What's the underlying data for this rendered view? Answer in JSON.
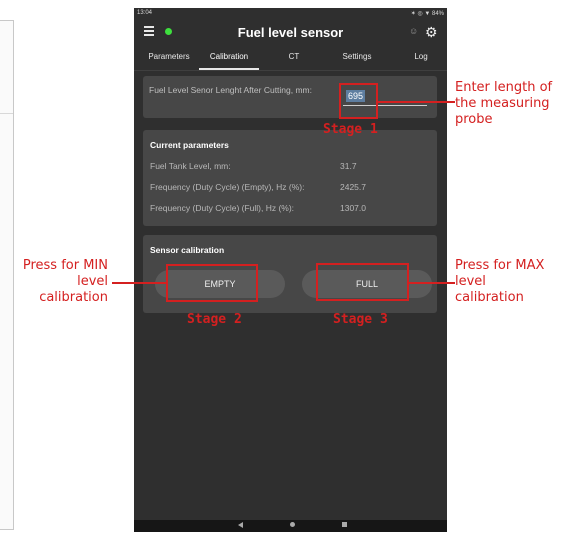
{
  "status_bar": {
    "time": "13:04",
    "right": "✶ ◎ ▼ 84%"
  },
  "app_bar": {
    "title": "Fuel level sensor"
  },
  "tabs": [
    {
      "label": "Parameters"
    },
    {
      "label": "Calibration"
    },
    {
      "label": "CT"
    },
    {
      "label": "Settings"
    },
    {
      "label": "Log"
    }
  ],
  "probe_field": {
    "label": "Fuel Level Senor Lenght After Cutting, mm:",
    "value": "695"
  },
  "current_parameters": {
    "title": "Current parameters",
    "rows": [
      {
        "label": "Fuel Tank Level, mm:",
        "value": "31.7"
      },
      {
        "label": "Frequency (Duty Cycle) (Empty), Hz (%):",
        "value": "2425.7"
      },
      {
        "label": "Frequency (Duty Cycle) (Full), Hz (%):",
        "value": "1307.0"
      }
    ]
  },
  "sensor_calibration": {
    "title": "Sensor calibration",
    "empty_label": "EMPTY",
    "full_label": "FULL"
  },
  "annotations": {
    "stage1": "Stage 1",
    "stage2": "Stage 2",
    "stage3": "Stage 3",
    "probe_note": [
      "Enter length of",
      "the measuring",
      "probe"
    ],
    "min_note": [
      "Press for MIN",
      "level",
      "calibration"
    ],
    "max_note": [
      "Press for MAX",
      "level",
      "calibration"
    ]
  },
  "colors": {
    "accent_red": "#d42020",
    "status_dot": "#3ee03e",
    "background": "#2f2f2f",
    "card": "#474747"
  }
}
